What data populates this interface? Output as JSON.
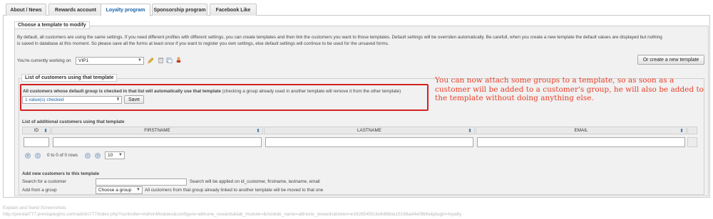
{
  "tabs": [
    {
      "label": "About / News"
    },
    {
      "label": "Rewards account"
    },
    {
      "label": "Loyalty program"
    },
    {
      "label": "Sponsorship program"
    },
    {
      "label": "Facebook Like"
    }
  ],
  "template_section": {
    "legend": "Choose a template to modify",
    "description_line1": "By default, all customers are using the same settings. If you need different profiles with different settings, you can create templates and then link the customers you want to those templates. Default settings will be overriden automatically. Be carefull, when you create a new template the default values are displayed but nothing",
    "description_line2": "is saved in database at this moment. So please save all the forms at least once if you want to register you own settings, else default settings will continue to be used for the unsaved forms.",
    "working_on_label": "You're currently working on",
    "working_on_value": "VIP1",
    "create_button": "Or create a new template"
  },
  "customers_section": {
    "legend": "List of customers using that template",
    "groups_label_bold": "All customers whose default group is checked in that list will automatically use that template",
    "groups_label_rest": "(checking a group already used in another template will remove it from the other template)",
    "groups_select_value": "1 value(s) checked",
    "save_button": "Save",
    "additional_title": "List of additional customers using that template",
    "columns": [
      "ID",
      "FIRSTNAME",
      "LASTNAME",
      "EMAIL"
    ],
    "pager_text": "0 to 0 of 0 rows",
    "page_size": "10",
    "add_title": "Add new customers to this template",
    "search_label": "Search for a customer",
    "search_hint": "Search will be applied on id_customer, firstname, lastname, email",
    "group_label": "Add from a group",
    "group_select_value": "Choose a group",
    "group_hint": "All customers from that group already linked to another template will be moved to that one"
  },
  "annotation": "You can now attach some groups to a template, so as soon as a customer will be added to a customer's group, he will also be added to the template without doing anything else.",
  "footer": {
    "line1": "Explain and Send Screenshots",
    "line2": "http://prestat777.prestaplugins.com/admin777/index.php?controller=AdminModules&configure=allinone_rewards&tab_module=&module_name=allinone_rewards&token=e1626545fc3e9d88da15168ad4e08bfe&plugin=loyalty"
  },
  "colors": {
    "accent": "#1a63a8",
    "annotation": "#e8402a",
    "callout_border": "#d42020"
  }
}
